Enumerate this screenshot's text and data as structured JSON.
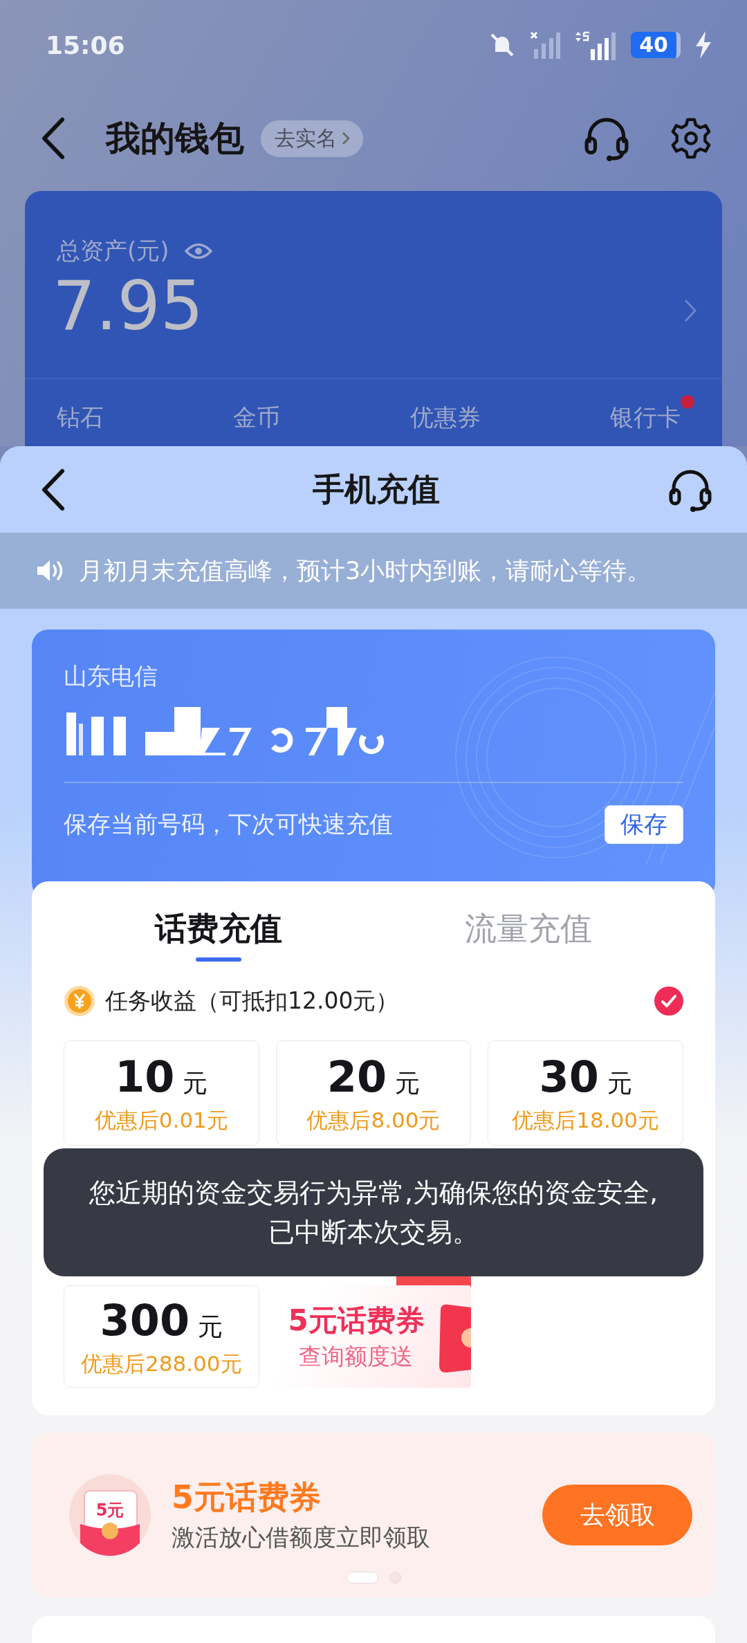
{
  "status_bar": {
    "time": "15:06",
    "battery": "40"
  },
  "wallet": {
    "title": "我的钱包",
    "verify_chip": "去实名",
    "total_label": "总资产(元)",
    "total_value": "7.95",
    "assets": [
      {
        "label": "钻石",
        "dot": false
      },
      {
        "label": "金币",
        "dot": false
      },
      {
        "label": "优惠券",
        "dot": false
      },
      {
        "label": "银行卡",
        "dot": true
      }
    ]
  },
  "sheet": {
    "title": "手机充值",
    "notice": "月初月末充值高峰，预计3小时内到账，请耐心等待。",
    "carrier": "山东电信",
    "save_hint": "保存当前号码，下次可快速充值",
    "save_button": "保存",
    "tabs": [
      {
        "label": "话费充值",
        "selected": true
      },
      {
        "label": "流量充值",
        "selected": false
      }
    ],
    "deduction": {
      "label": "任务收益（可抵扣12.00元）",
      "checked": true
    },
    "amounts": [
      {
        "kind": "amount",
        "amount": "10",
        "unit": "元",
        "price": "优惠后0.01元"
      },
      {
        "kind": "amount",
        "amount": "20",
        "unit": "元",
        "price": "优惠后8.00元"
      },
      {
        "kind": "amount",
        "amount": "30",
        "unit": "元",
        "price": "优惠后18.00元"
      },
      {
        "kind": "amount",
        "amount": "300",
        "unit": "元",
        "price": "优惠后288.00元"
      },
      {
        "kind": "promo",
        "title": "5元话费券",
        "subtitle": "查询额度送"
      }
    ],
    "promo": {
      "icon_label": "5元",
      "title": "5元话费券",
      "subtitle": "激活放心借额度立即领取",
      "button": "去领取",
      "carousel_dots": [
        {
          "selected": true
        },
        {
          "selected": false
        }
      ]
    }
  },
  "toast": {
    "message": "您近期的资金交易行为异常,为确保您的资金安全,\n已中断本次交易。"
  }
}
